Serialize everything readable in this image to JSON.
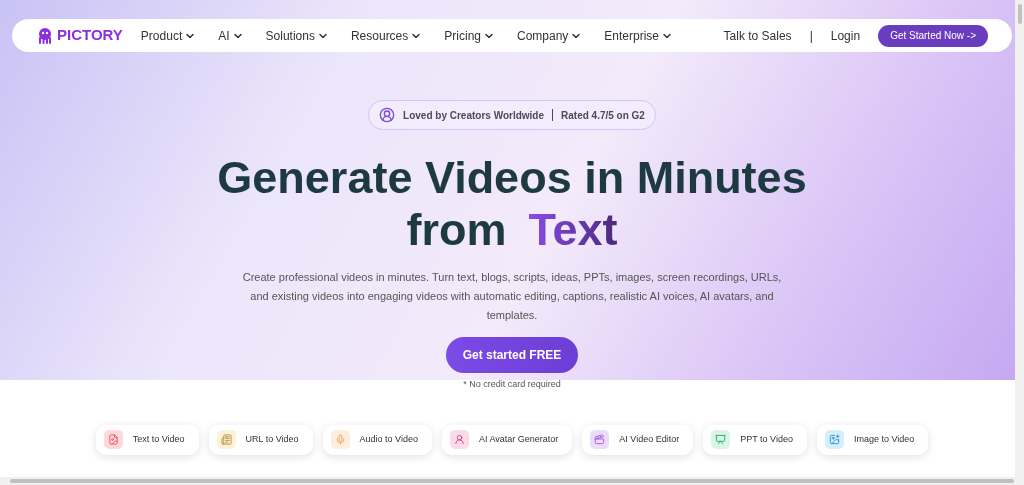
{
  "nav": {
    "logo": "PICTORY",
    "menu": [
      {
        "label": "Product"
      },
      {
        "label": "AI"
      },
      {
        "label": "Solutions"
      },
      {
        "label": "Resources"
      },
      {
        "label": "Pricing"
      },
      {
        "label": "Company"
      },
      {
        "label": "Enterprise"
      }
    ],
    "talk": "Talk to Sales",
    "separator": "|",
    "login": "Login",
    "cta": "Get Started Now ->"
  },
  "hero": {
    "badge": {
      "left": "Loved by Creators Worldwide",
      "right": "Rated 4.7/5 on G2"
    },
    "headline_line1": "Generate Videos in Minutes",
    "headline_lead": "from",
    "headline_highlight": "Text",
    "description": "Create professional videos in minutes. Turn text, blogs, scripts, ideas, PPTs, images, screen recordings, URLs, and existing videos into engaging videos with automatic editing, captions, realistic AI voices, AI avatars, and templates.",
    "button": "Get started FREE",
    "note": "* No credit card required"
  },
  "features": [
    {
      "label": "Text to Video",
      "kind": "text",
      "color": "#fdd9dc"
    },
    {
      "label": "URL to Video",
      "kind": "url",
      "color": "#fcf1d9"
    },
    {
      "label": "Audio to Video",
      "kind": "audio",
      "color": "#fdeedd"
    },
    {
      "label": "AI Avatar Generator",
      "kind": "avatar",
      "color": "#fcdbe8"
    },
    {
      "label": "AI Video Editor",
      "kind": "editor",
      "color": "#ecdcfb"
    },
    {
      "label": "PPT to Video",
      "kind": "ppt",
      "color": "#d8f5e6"
    },
    {
      "label": "Image to Video",
      "kind": "image",
      "color": "#d5effc"
    }
  ]
}
